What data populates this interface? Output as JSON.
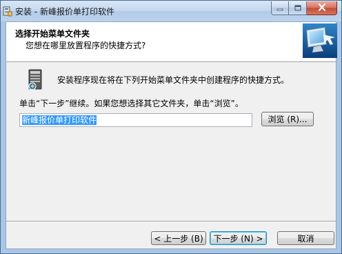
{
  "window": {
    "title": "安装 - 新峰报价单打印软件",
    "icon": "setup-app-icon",
    "controls": [
      "minimize-icon",
      "maximize-icon",
      "close-icon"
    ]
  },
  "header": {
    "title": "选择开始菜单文件夹",
    "subtitle": "您想在哪里放置程序的快捷方式?",
    "image": "setup-wizard-computer-image"
  },
  "body": {
    "icon": "start-menu-folder-icon",
    "info": "安装程序现在将在下列开始菜单文件夹中创建程序的快捷方式。",
    "instruction": "单击“下一步”继续。如果您想选择其它文件夹，单击“浏览”。",
    "folder_value": "新峰报价单打印软件",
    "browse_label": "浏览 (R)..."
  },
  "footer": {
    "back_label": "< 上一步 (B)",
    "next_label": "下一步 (N) >",
    "cancel_label": "取消"
  },
  "colors": {
    "selection": "#3399ff",
    "titlebar": "#c3d7ee",
    "client_bg": "#f0f0f0"
  }
}
